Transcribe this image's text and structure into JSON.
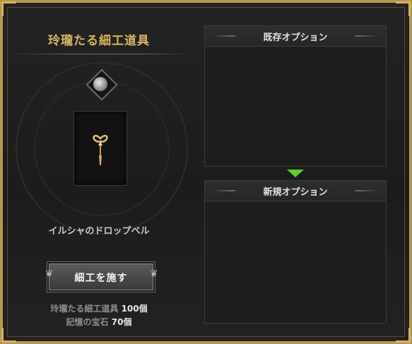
{
  "tool": {
    "title": "玲瓏たる細工道具",
    "item_name": "イルシャのドロップベル",
    "craft_button_label": "細工を施す",
    "costs": [
      {
        "label": "玲瓏たる細工道具",
        "value": "100個"
      },
      {
        "label": "記憶の宝石",
        "value": "70個"
      }
    ]
  },
  "panels": {
    "existing_title": "既存オプション",
    "new_title": "新規オプション"
  },
  "colors": {
    "accent_gold": "#d8b45c",
    "arrow_green": "#5ed026",
    "frame_gold": "#b8974e"
  },
  "icons": {
    "gem": "memory-gem-icon",
    "item": "drop-bell-icon",
    "arrow": "arrow-down-icon"
  }
}
